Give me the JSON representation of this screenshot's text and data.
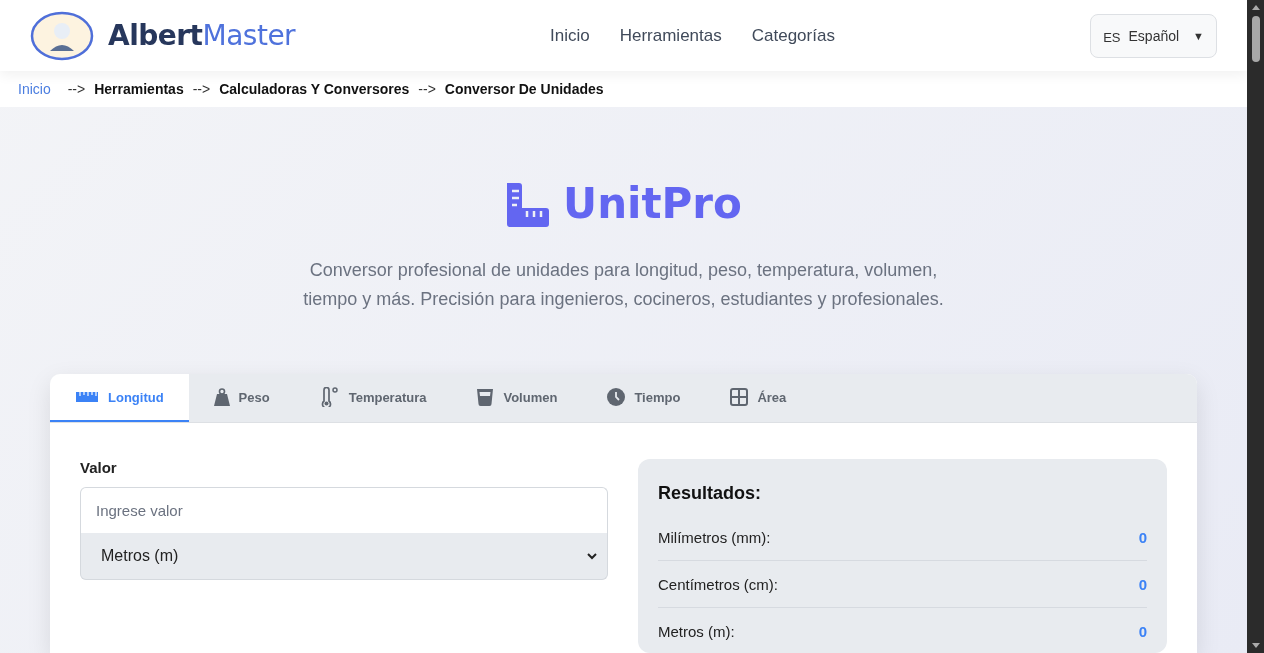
{
  "header": {
    "brand": {
      "part_1": "Albert",
      "part_2": "Master"
    },
    "nav": [
      "Inicio",
      "Herramientas",
      "Categorías"
    ],
    "language": {
      "code": "ES",
      "label": "Español",
      "caret": "▼"
    }
  },
  "breadcrumb": [
    {
      "label": "Inicio",
      "link": true
    },
    {
      "label": "Herramientas",
      "link": false
    },
    {
      "label": "Calculadoras Y Conversores",
      "link": false
    },
    {
      "label": "Conversor De Unidades",
      "link": false
    }
  ],
  "breadcrumb_separator": "-->",
  "hero": {
    "title": "UnitPro",
    "description": "Conversor profesional de unidades para longitud, peso, temperatura, volumen, tiempo y más. Precisión para ingenieros, cocineros, estudiantes y profesionales."
  },
  "tabs": [
    {
      "label": "Longitud",
      "kind": "ruler",
      "selected": true
    },
    {
      "label": "Peso",
      "kind": "weight",
      "selected": false
    },
    {
      "label": "Temperatura",
      "kind": "thermometer",
      "selected": false
    },
    {
      "label": "Volumen",
      "kind": "glass",
      "selected": false
    },
    {
      "label": "Tiempo",
      "kind": "clock",
      "selected": false
    },
    {
      "label": "Área",
      "kind": "grid",
      "selected": false
    }
  ],
  "input": {
    "label": "Valor",
    "placeholder": "Ingrese valor",
    "unit": "Metros (m)"
  },
  "results": {
    "title": "Resultados:",
    "rows": [
      {
        "label": "Milímetros (mm):",
        "value": "0"
      },
      {
        "label": "Centímetros (cm):",
        "value": "0"
      },
      {
        "label": "Metros (m):",
        "value": "0"
      }
    ]
  }
}
